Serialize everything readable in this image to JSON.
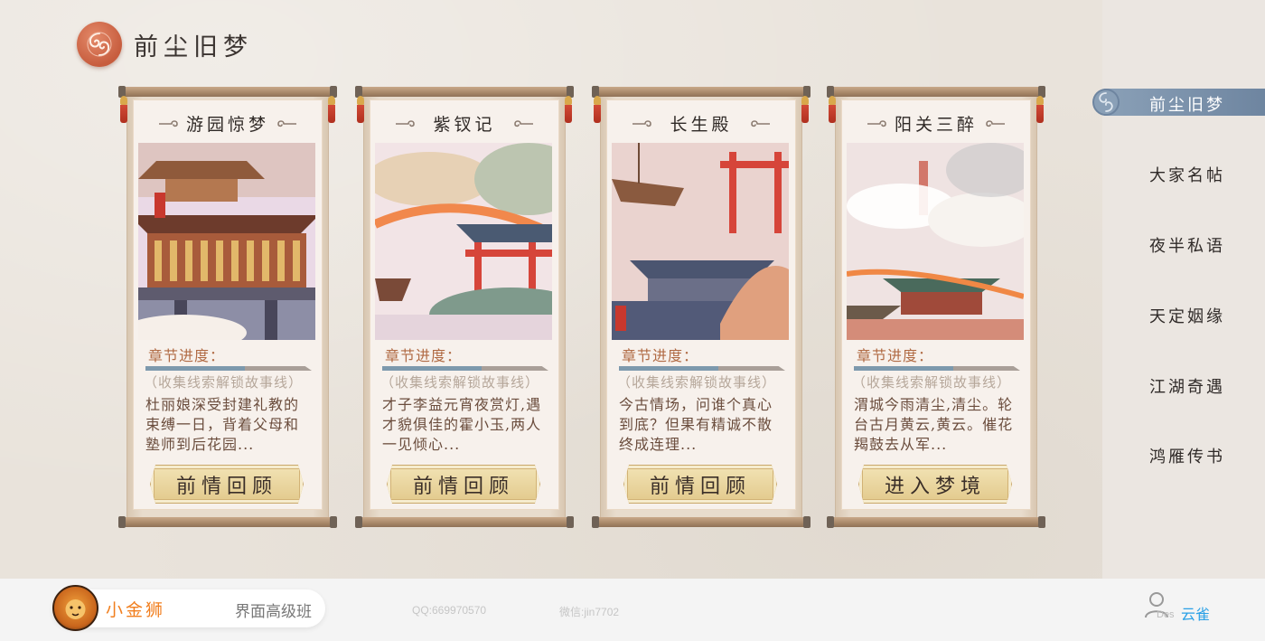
{
  "header": {
    "title": "前尘旧梦",
    "logo_icon": "cloud-swirl-icon"
  },
  "scrolls": [
    {
      "title": "游园惊梦",
      "progress_label": "章节进度：",
      "progress_value": 0.6,
      "hint": "（收集线索解锁故事线）",
      "summary": "杜丽娘深受封建礼教的束缚一日，背着父母和塾师到后花园...",
      "button": "前情回顾"
    },
    {
      "title": "紫钗记",
      "progress_label": "章节进度：",
      "progress_value": 0.6,
      "hint": "（收集线索解锁故事线）",
      "summary": "才子李益元宵夜赏灯,遇才貌俱佳的霍小玉,两人一见倾心...",
      "button": "前情回顾"
    },
    {
      "title": "长生殿",
      "progress_label": "章节进度：",
      "progress_value": 0.6,
      "hint": "（收集线索解锁故事线）",
      "summary": "今古情场，问谁个真心到底？但果有精诚不散终成连理...",
      "button": "前情回顾"
    },
    {
      "title": "阳关三醉",
      "progress_label": "章节进度：",
      "progress_value": 0.6,
      "hint": "（收集线索解锁故事线）",
      "summary": "渭城今雨清尘,清尘。轮台古月黄云,黄云。催花羯鼓去从军...",
      "button": "进入梦境"
    }
  ],
  "side_nav": {
    "active_index": 0,
    "items": [
      "前尘旧梦",
      "大家名帖",
      "夜半私语",
      "天定姻缘",
      "江湖奇遇",
      "鸿雁传书"
    ]
  },
  "footer": {
    "brand_name": "小金狮",
    "course": "界面高级班",
    "qq": "QQ:669970570",
    "wechat": "微信:jin7702",
    "user_sub": "Des",
    "user_name": "云雀"
  },
  "colors": {
    "accent_red": "#c75d3e",
    "nav_active": "#7a90aa",
    "progress_fill": "#7d99ad",
    "brand_orange": "#f17f1f",
    "user_blue": "#2aa0e6"
  }
}
